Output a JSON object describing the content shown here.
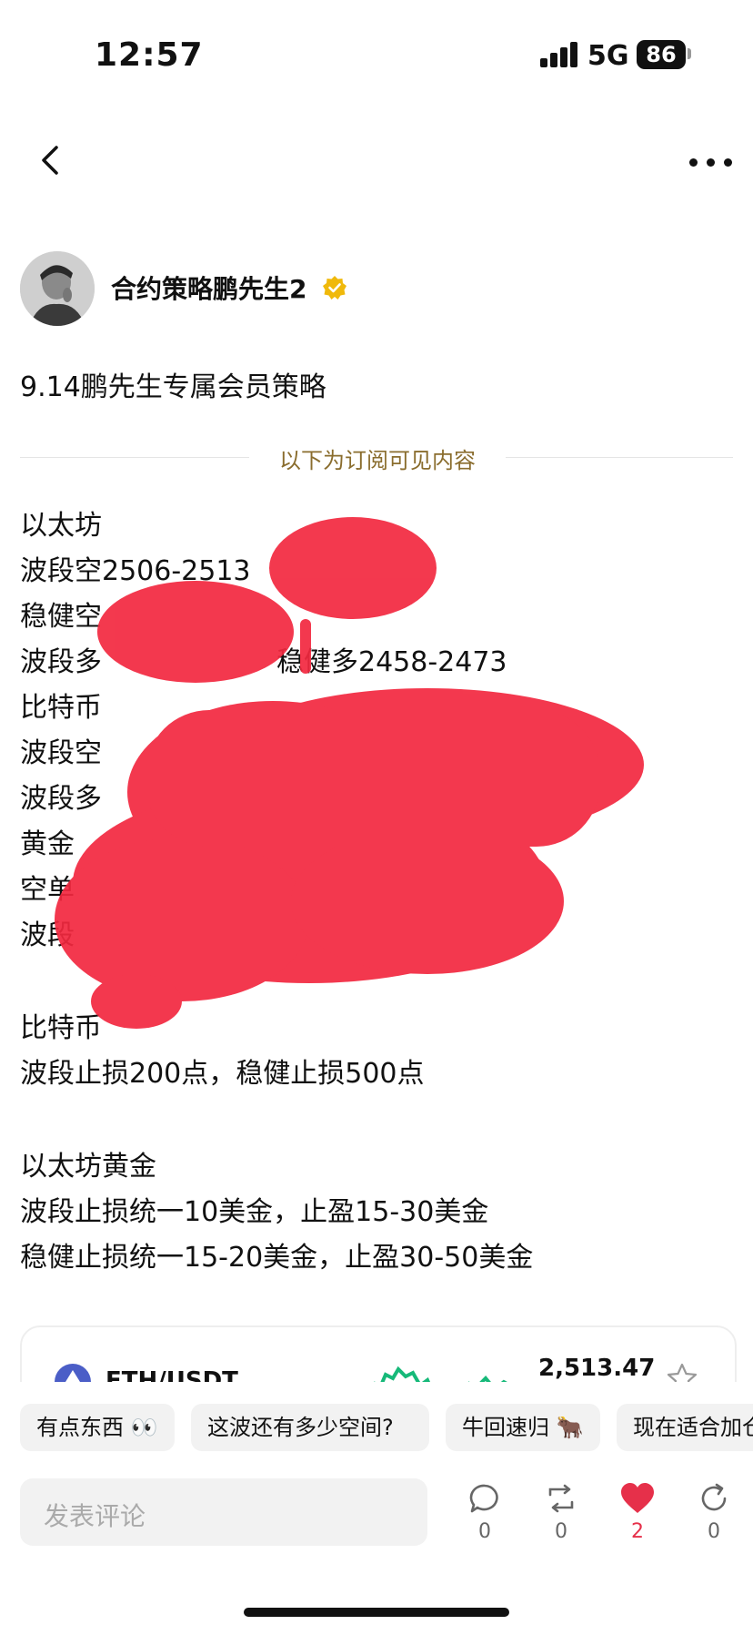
{
  "status_bar": {
    "time": "12:57",
    "network": "5G",
    "battery": "86"
  },
  "nav": {
    "back_icon": "chevron-left-icon",
    "more_icon": "ellipsis-icon"
  },
  "author": {
    "name": "合约策略鹏先生2",
    "verified_icon": "verified-badge-icon"
  },
  "post": {
    "title": "9.14鹏先生专属会员策略",
    "subscription_divider": "以下为订阅可见内容",
    "lines": [
      "以太坊",
      "波段空2506-2513",
      "稳健空",
      "波段多",
      "比特币",
      "波段空",
      "波段多",
      "黄金",
      "空单",
      "波段",
      "比特币",
      "波段止损200点，稳健止损500点",
      "以太坊黄金",
      "波段止损统一10美金，止盈15-30美金",
      "稳健止损统一15-20美金，止盈30-50美金"
    ],
    "partial": {
      "eth_fragment": "稳健多2458-2473"
    }
  },
  "market_card": {
    "pair": "ETH/USDT",
    "price": "2,513.47",
    "trend_color": "#16b979",
    "icon": "star-icon"
  },
  "quick_replies": [
    "有点东西 👀",
    "这波还有多少空间?",
    "牛回速归 🐂",
    "现在适合加仓吗"
  ],
  "comment": {
    "placeholder": "发表评论"
  },
  "actions": {
    "comment": {
      "icon": "comment-icon",
      "count": "0"
    },
    "repost": {
      "icon": "repost-icon",
      "count": "0"
    },
    "like": {
      "icon": "heart-icon",
      "count": "2",
      "color": "#e6304a"
    },
    "share": {
      "icon": "share-icon",
      "count": "0"
    }
  }
}
